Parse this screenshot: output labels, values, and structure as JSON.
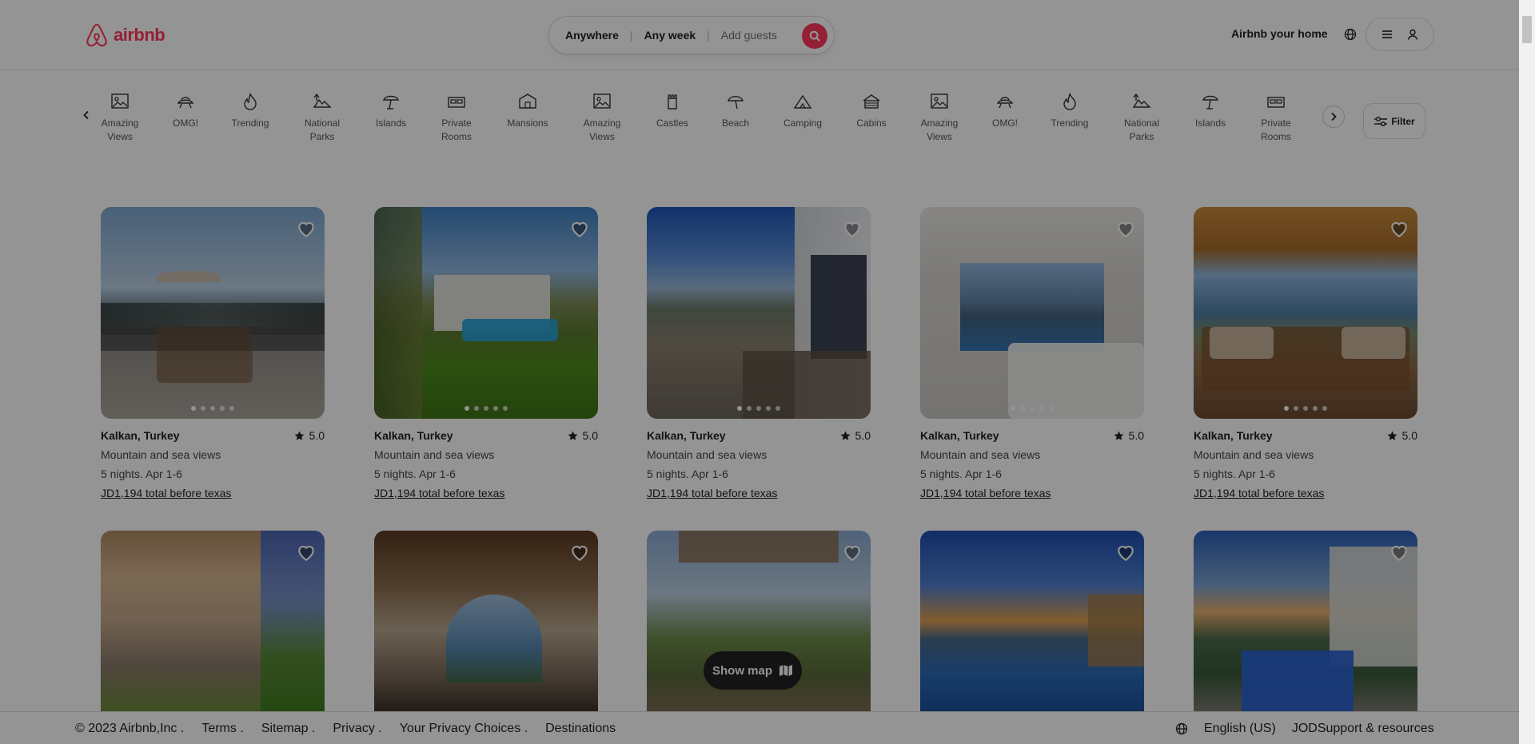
{
  "header": {
    "logo_text": "airbnb",
    "search": {
      "anywhere": "Anywhere",
      "any_week": "Any week",
      "add_guests": "Add guests",
      "sep": "|"
    },
    "host_link": "Airbnb your home"
  },
  "categories": [
    {
      "label": "Amazing Views",
      "icon": "amazing-views-icon"
    },
    {
      "label": "OMG!",
      "icon": "omg-icon"
    },
    {
      "label": "Trending",
      "icon": "trending-icon"
    },
    {
      "label": "National Parks",
      "icon": "national-parks-icon"
    },
    {
      "label": "Islands",
      "icon": "islands-icon"
    },
    {
      "label": "Private Rooms",
      "icon": "private-rooms-icon"
    },
    {
      "label": "Mansions",
      "icon": "mansions-icon"
    },
    {
      "label": "Amazing Views",
      "icon": "amazing-views-icon"
    },
    {
      "label": "Castles",
      "icon": "castles-icon"
    },
    {
      "label": "Beach",
      "icon": "beach-icon"
    },
    {
      "label": "Camping",
      "icon": "camping-icon"
    },
    {
      "label": "Cabins",
      "icon": "cabins-icon"
    },
    {
      "label": "Amazing Views",
      "icon": "amazing-views-icon"
    },
    {
      "label": "OMG!",
      "icon": "omg-icon"
    },
    {
      "label": "Trending",
      "icon": "trending-icon"
    },
    {
      "label": "National Parks",
      "icon": "national-parks-icon"
    },
    {
      "label": "Islands",
      "icon": "islands-icon"
    },
    {
      "label": "Private Rooms",
      "icon": "private-rooms-icon"
    }
  ],
  "filter_label": "Filter",
  "listings": [
    {
      "location": "Kalkan, Turkey",
      "rating": "5.0",
      "description": "Mountain and sea views",
      "dates": "5 nights. Apr 1-6",
      "price": "JD1,194 total before texas"
    },
    {
      "location": "Kalkan, Turkey",
      "rating": "5.0",
      "description": "Mountain and sea views",
      "dates": "5 nights. Apr 1-6",
      "price": "JD1,194 total before texas"
    },
    {
      "location": "Kalkan, Turkey",
      "rating": "5.0",
      "description": "Mountain and sea views",
      "dates": "5 nights. Apr 1-6",
      "price": "JD1,194 total before texas"
    },
    {
      "location": "Kalkan, Turkey",
      "rating": "5.0",
      "description": "Mountain and sea views",
      "dates": "5 nights. Apr 1-6",
      "price": "JD1,194 total before texas"
    },
    {
      "location": "Kalkan, Turkey",
      "rating": "5.0",
      "description": "Mountain and sea views",
      "dates": "5 nights. Apr 1-6",
      "price": "JD1,194 total before texas"
    }
  ],
  "show_map_label": "Show map",
  "footer": {
    "copyright": "© 2023 Airbnb,Inc .",
    "terms": "Terms .",
    "sitemap": "Sitemap .",
    "privacy": "Privacy .",
    "privacy_choices": "Your Privacy Choices .",
    "destinations": "Destinations",
    "language": "English (US)",
    "currency_support": "JODSupport & resources"
  },
  "colors": {
    "brand": "#ff385c",
    "overlay": "rgba(0,0,0,0.42)"
  }
}
